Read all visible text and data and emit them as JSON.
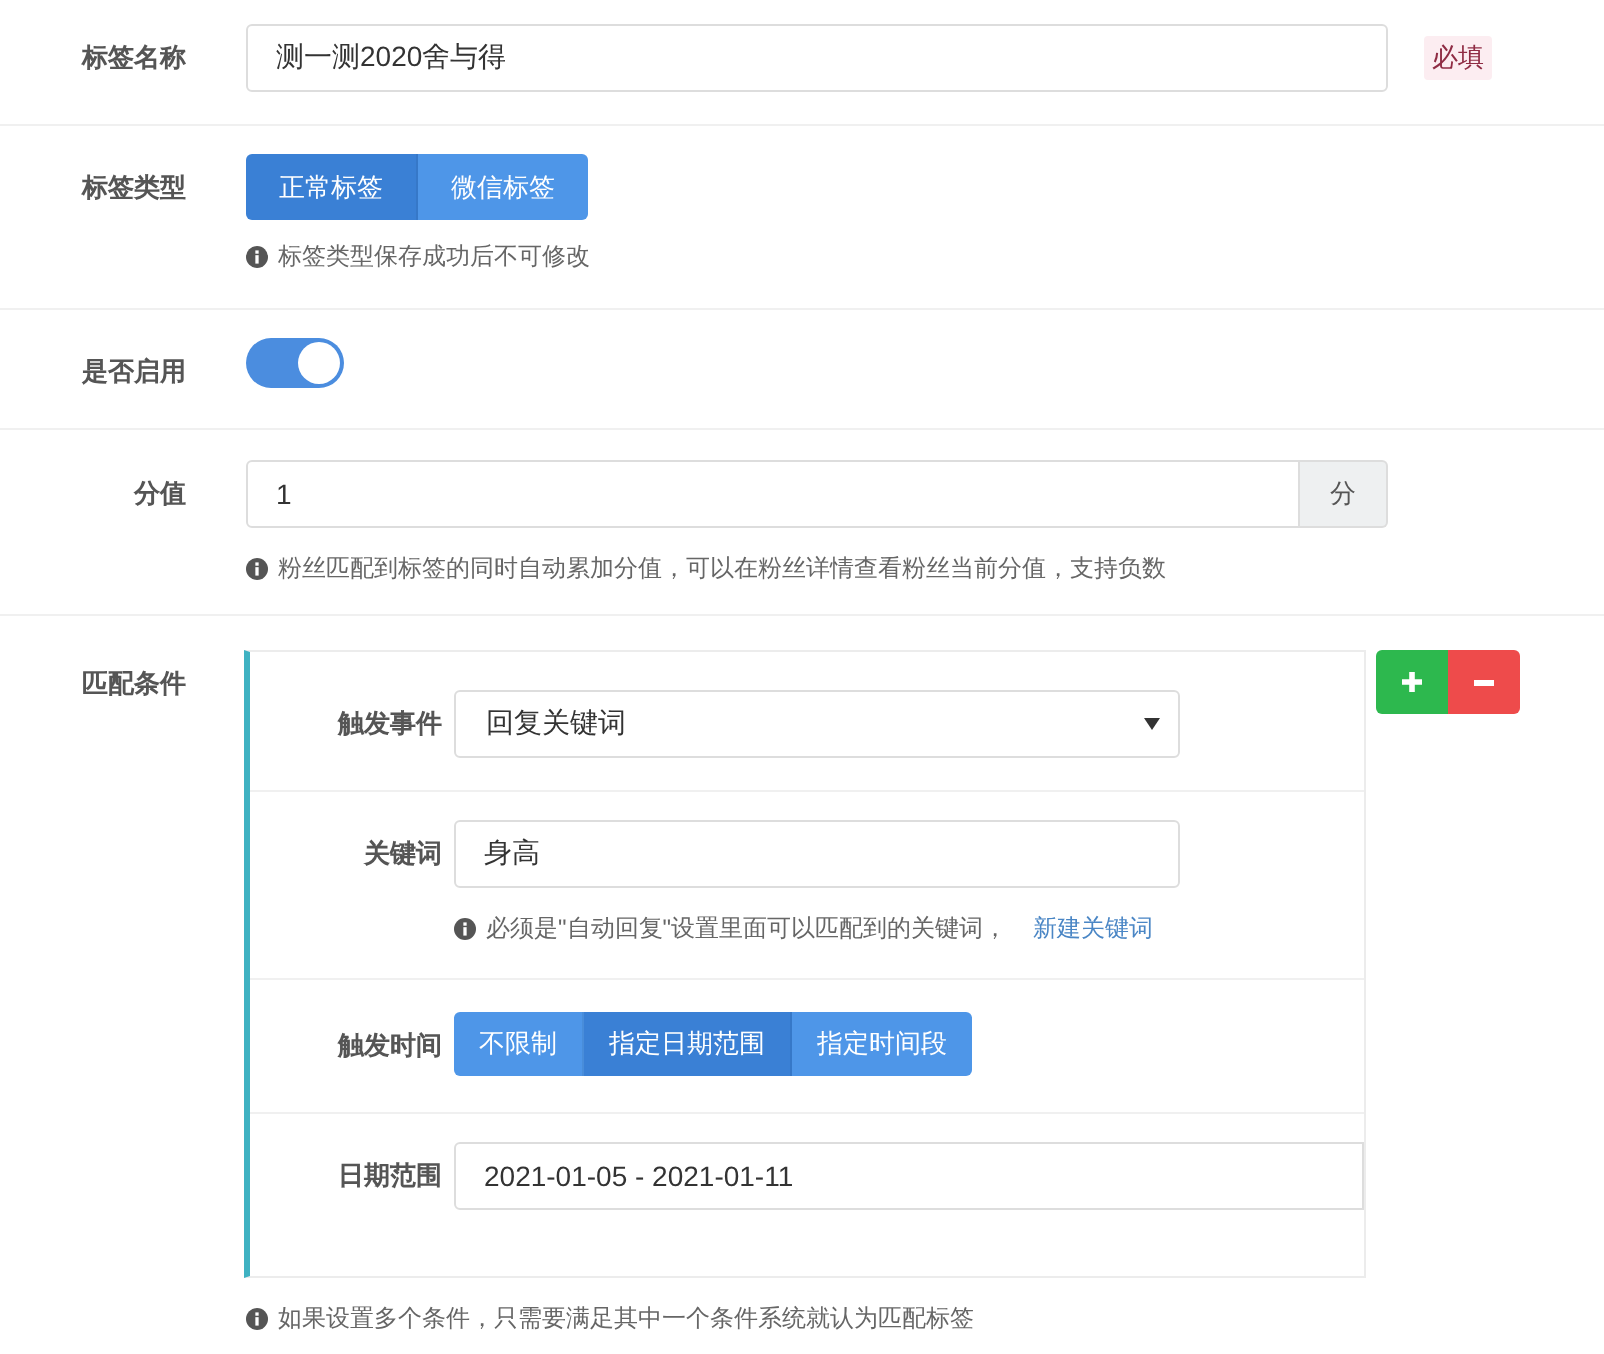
{
  "fields": [
    {
      "kind": "text",
      "label": "标签名称",
      "value": "测一测2020舍与得",
      "badge": "必填"
    },
    {
      "kind": "segmented",
      "label": "标签类型",
      "options": [
        {
          "label": "正常标签",
          "selected": true
        },
        {
          "label": "微信标签",
          "selected": false
        }
      ],
      "help": "标签类型保存成功后不可修改"
    },
    {
      "kind": "toggle",
      "label": "是否启用",
      "on": true
    },
    {
      "kind": "addon",
      "label": "分值",
      "value": "1",
      "addon": "分",
      "help": "粉丝匹配到标签的同时自动累加分值，可以在粉丝详情查看粉丝当前分值，支持负数"
    },
    {
      "kind": "conditions",
      "label": "匹配条件",
      "conditions": [
        {
          "rows": [
            {
              "kind": "select",
              "label": "触发事件",
              "value": "回复关键词"
            },
            {
              "kind": "text",
              "label": "关键词",
              "value": "身高",
              "help": "必须是\"自动回复\"设置里面可以匹配到的关键词，",
              "link": "新建关键词"
            },
            {
              "kind": "segmented",
              "label": "触发时间",
              "options": [
                {
                  "label": "不限制",
                  "selected": false
                },
                {
                  "label": "指定日期范围",
                  "selected": true
                },
                {
                  "label": "指定时间段",
                  "selected": false
                }
              ]
            },
            {
              "kind": "daterange",
              "label": "日期范围",
              "value": "2021-01-05 - 2021-01-11"
            }
          ]
        }
      ],
      "actions": [
        {
          "kind": "add"
        },
        {
          "kind": "remove"
        }
      ],
      "help": "如果设置多个条件，只需要满足其中一个条件系统就认为匹配标签"
    }
  ]
}
